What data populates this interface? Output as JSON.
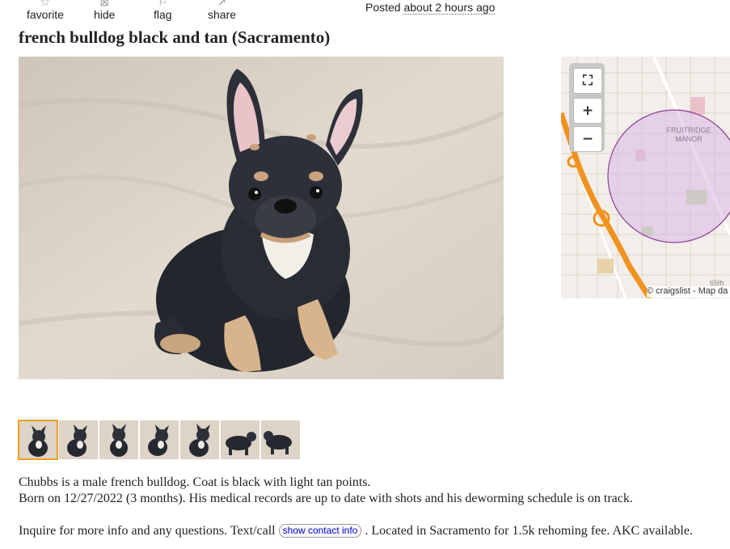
{
  "actions": [
    {
      "label": "favorite",
      "icon": "star-icon"
    },
    {
      "label": "hide",
      "icon": "hide-icon"
    },
    {
      "label": "flag",
      "icon": "flag-icon"
    },
    {
      "label": "share",
      "icon": "share-icon"
    }
  ],
  "posted": {
    "prefix": "Posted",
    "time": "about 2 hours ago"
  },
  "title": "french bulldog black and tan (Sacramento)",
  "map": {
    "area_label_1": "FRUITRIDGE",
    "area_label_2": "MANOR",
    "street_label": "65th",
    "attribution": "© craigslist - Map da",
    "controls": {
      "fullscreen": "⛶",
      "zoom_in": "+",
      "zoom_out": "−"
    }
  },
  "thumbnails": {
    "count": 7,
    "selected_index": 0
  },
  "description": {
    "line1": "Chubbs is a male french bulldog. Coat is black with light tan points.",
    "line2": "Born on 12/27/2022 (3 months). His medical records are up to date with shots and his deworming schedule is on track.",
    "line3_before": "Inquire for more info and any questions. Text/call",
    "contact_button": "show contact info",
    "line3_after": ". Located in Sacramento for 1.5k rehoming fee. AKC available."
  },
  "colors": {
    "accent": "#f0a020",
    "link": "#0000cc",
    "route": "#f0931e",
    "radius": "#8b3c9c"
  }
}
